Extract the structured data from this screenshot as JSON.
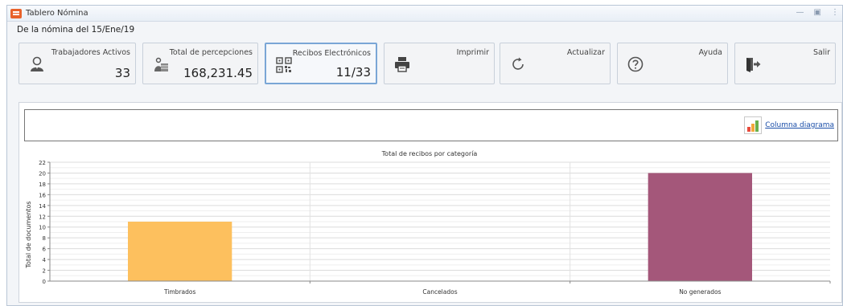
{
  "window": {
    "title": "Tablero Nómina",
    "controls": [
      "—",
      "▣",
      "⋮"
    ]
  },
  "nomina_label": "De la nómina del 15/Ene/19",
  "cards": [
    {
      "id": "trabajadores",
      "label": "Trabajadores Activos",
      "value": "33",
      "icon": "user-icon"
    },
    {
      "id": "percepciones",
      "label": "Total de percepciones",
      "value": "168,231.45",
      "icon": "money-bag-icon"
    },
    {
      "id": "recibos",
      "label": "Recibos Electrónicos",
      "value": "11/33",
      "icon": "qr-code-icon"
    },
    {
      "id": "imprimir",
      "label": "Imprimir",
      "value": "",
      "icon": "printer-icon"
    },
    {
      "id": "actualizar",
      "label": "Actualizar",
      "value": "",
      "icon": "refresh-icon"
    },
    {
      "id": "ayuda",
      "label": "Ayuda",
      "value": "",
      "icon": "help-icon"
    },
    {
      "id": "salir",
      "label": "Salir",
      "value": "",
      "icon": "exit-icon"
    }
  ],
  "diagram_link": "Columna diagrama",
  "colors": {
    "timbrados": "#fdc05e",
    "no_generados": "#a4577a",
    "accent": "#7aa6d6"
  },
  "chart_data": {
    "type": "bar",
    "title": "Total de recibos por categoría",
    "xlabel": "",
    "ylabel": "Total de documentos",
    "categories": [
      "Timbrados",
      "Cancelados",
      "No generados"
    ],
    "values": [
      11,
      0,
      20
    ],
    "ylim": [
      0,
      22
    ],
    "yticks": [
      0,
      2,
      4,
      6,
      8,
      10,
      12,
      14,
      16,
      18,
      20,
      22
    ],
    "grid": true
  }
}
